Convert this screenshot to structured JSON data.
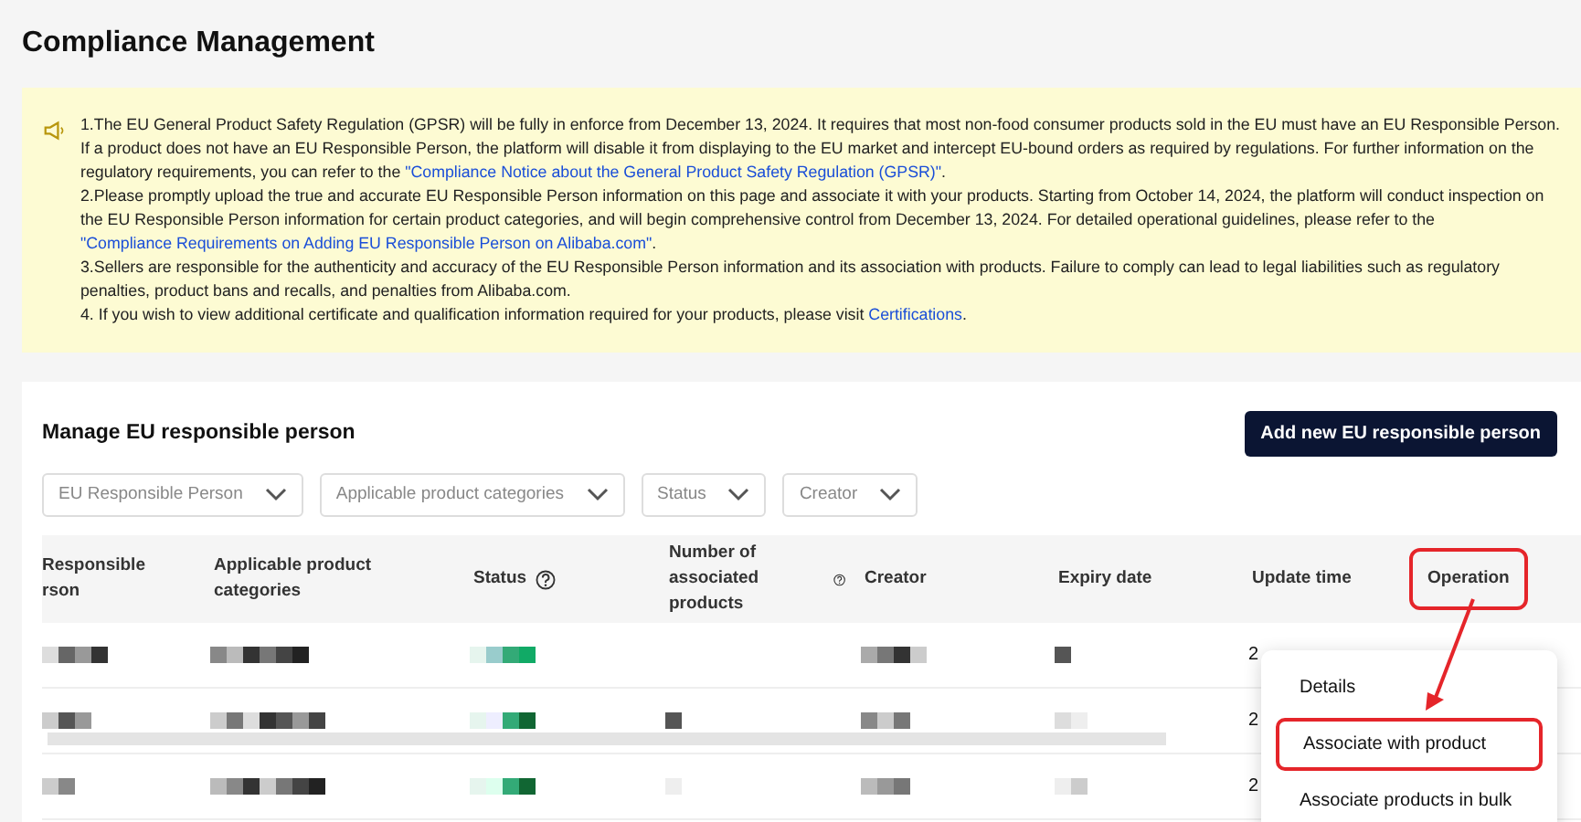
{
  "page_title": "Compliance Management",
  "notice": {
    "paragraphs": [
      {
        "text": "1.The EU General Product Safety Regulation (GPSR) will be fully in enforce from December 13, 2024. It requires that most non-food consumer products sold in the EU must have an EU Responsible Person. If a product does not have an EU Responsible Person, the platform will disable it from displaying to the EU market and intercept EU-bound orders as required by regulations. For further information on the regulatory requirements, you can refer to the ",
        "link": "\"Compliance Notice about the General Product Safety Regulation (GPSR)\"",
        "after": "."
      },
      {
        "text": "2.Please promptly upload the true and accurate EU Responsible Person information on this page and associate it with your products. Starting from October 14, 2024, the platform will conduct inspection on the EU Responsible Person information for certain product categories, and will begin comprehensive control from December 13, 2024. For detailed operational guidelines, please refer to the ",
        "link": "\"Compliance Requirements on Adding EU Responsible Person on Alibaba.com\"",
        "after": "."
      },
      {
        "text": "3.Sellers are responsible for the authenticity and accuracy of the EU Responsible Person information and its association with products. Failure to comply can lead to legal liabilities such as regulatory penalties, product bans and recalls, and penalties from Alibaba.com."
      },
      {
        "text": "4. If you wish to view additional certificate and qualification information required for your products, please visit ",
        "link": "Certifications",
        "after": "."
      }
    ]
  },
  "section": {
    "title": "Manage EU responsible person",
    "add_button": "Add new EU responsible person",
    "filters": [
      "EU Responsible Person",
      "Applicable product categories",
      "Status",
      "Creator"
    ]
  },
  "table": {
    "columns": [
      {
        "label": "Responsible rson",
        "help": false,
        "highlighted": false
      },
      {
        "label": "Applicable product categories",
        "help": false,
        "highlighted": false
      },
      {
        "label": "Status",
        "help": true,
        "highlighted": false
      },
      {
        "label": "Number of associated products",
        "help": true,
        "highlighted": false
      },
      {
        "label": "Creator",
        "help": false,
        "highlighted": false
      },
      {
        "label": "Expiry date",
        "help": false,
        "highlighted": false
      },
      {
        "label": "Update time",
        "help": false,
        "highlighted": false
      },
      {
        "label": "Operation",
        "help": false,
        "highlighted": true
      }
    ],
    "rows": [
      {
        "update_time": "2"
      },
      {
        "update_time": "2"
      },
      {
        "update_time": "2"
      }
    ]
  },
  "menu": {
    "items": [
      {
        "label": "Details",
        "highlighted": false
      },
      {
        "label": "Associate with product",
        "highlighted": true
      },
      {
        "label": "Associate products in bulk",
        "highlighted": false
      }
    ]
  }
}
